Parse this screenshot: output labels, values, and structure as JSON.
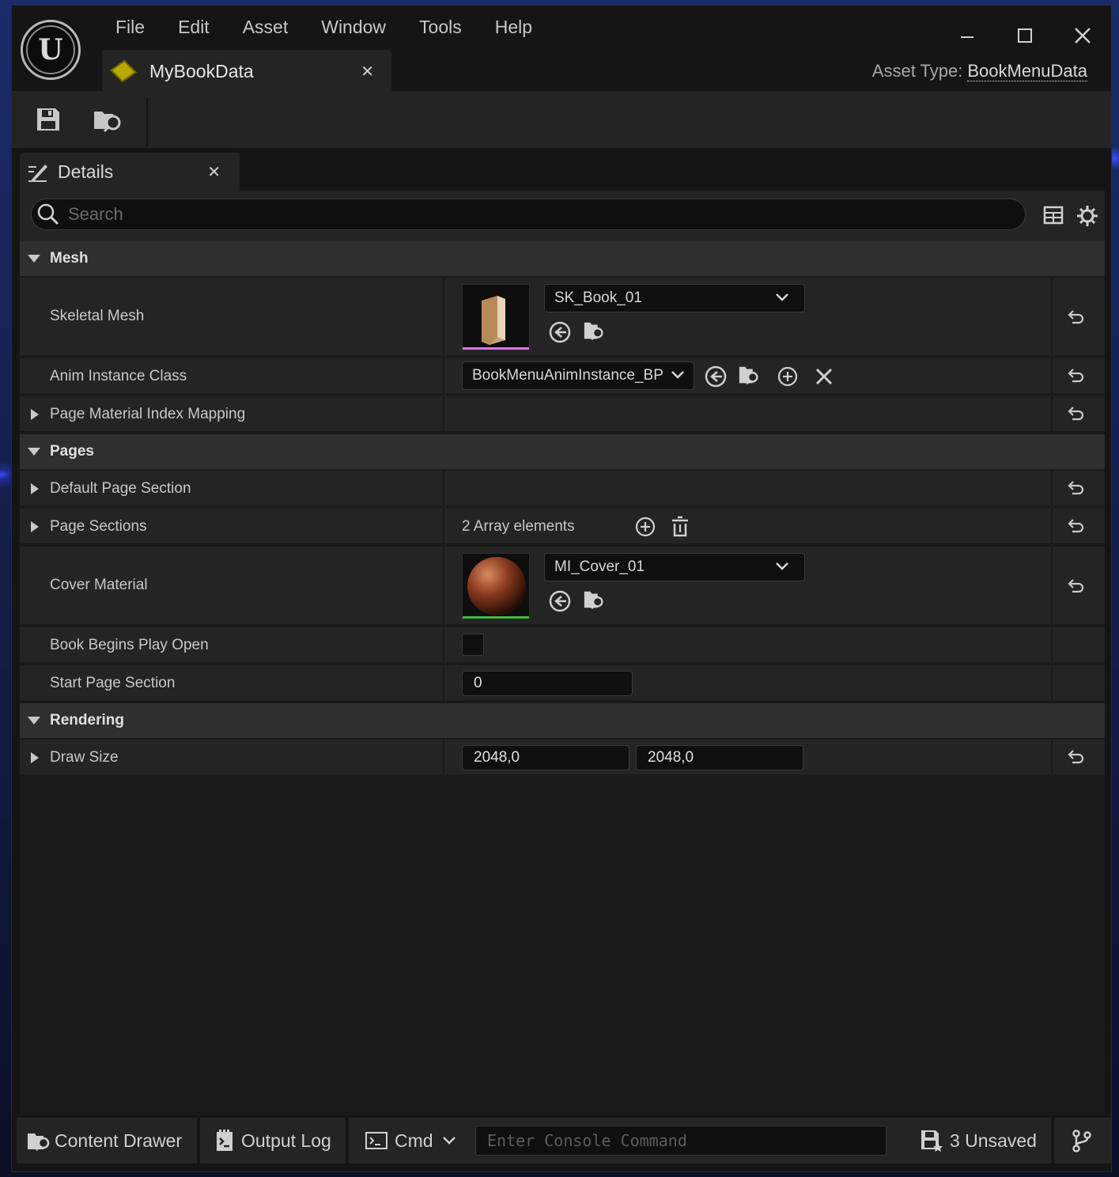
{
  "window": {
    "menu": [
      "File",
      "Edit",
      "Asset",
      "Window",
      "Tools",
      "Help"
    ],
    "asset_tab": {
      "label": "MyBookData"
    },
    "asset_type": {
      "label": "Asset Type:",
      "value": "BookMenuData"
    }
  },
  "details": {
    "tab_label": "Details",
    "search_placeholder": "Search",
    "sections": {
      "mesh": {
        "label": "Mesh",
        "skeletal_mesh": {
          "label": "Skeletal Mesh",
          "value": "SK_Book_01"
        },
        "anim_instance_class": {
          "label": "Anim Instance Class",
          "value": "BookMenuAnimInstance_BP"
        },
        "page_material_index_mapping": {
          "label": "Page Material Index Mapping"
        }
      },
      "pages": {
        "label": "Pages",
        "default_page_section": {
          "label": "Default Page Section"
        },
        "page_sections": {
          "label": "Page Sections",
          "value": "2 Array elements"
        },
        "cover_material": {
          "label": "Cover Material",
          "value": "MI_Cover_01"
        },
        "book_begins_play_open": {
          "label": "Book Begins Play Open",
          "checked": false
        },
        "start_page_section": {
          "label": "Start Page Section",
          "value": "0"
        }
      },
      "rendering": {
        "label": "Rendering",
        "draw_size": {
          "label": "Draw Size",
          "x": "2048,0",
          "y": "2048,0"
        }
      }
    }
  },
  "statusbar": {
    "content_drawer": "Content Drawer",
    "output_log": "Output Log",
    "cmd": "Cmd",
    "console_placeholder": "Enter Console Command",
    "unsaved": "3 Unsaved"
  },
  "colors": {
    "background": "#151515",
    "panel": "#242424",
    "section_header": "#2f2f2f",
    "asset_icon": "#b8a800",
    "mesh_thumb_underline": "#e070e8",
    "material_thumb_underline": "#3fb83f"
  }
}
